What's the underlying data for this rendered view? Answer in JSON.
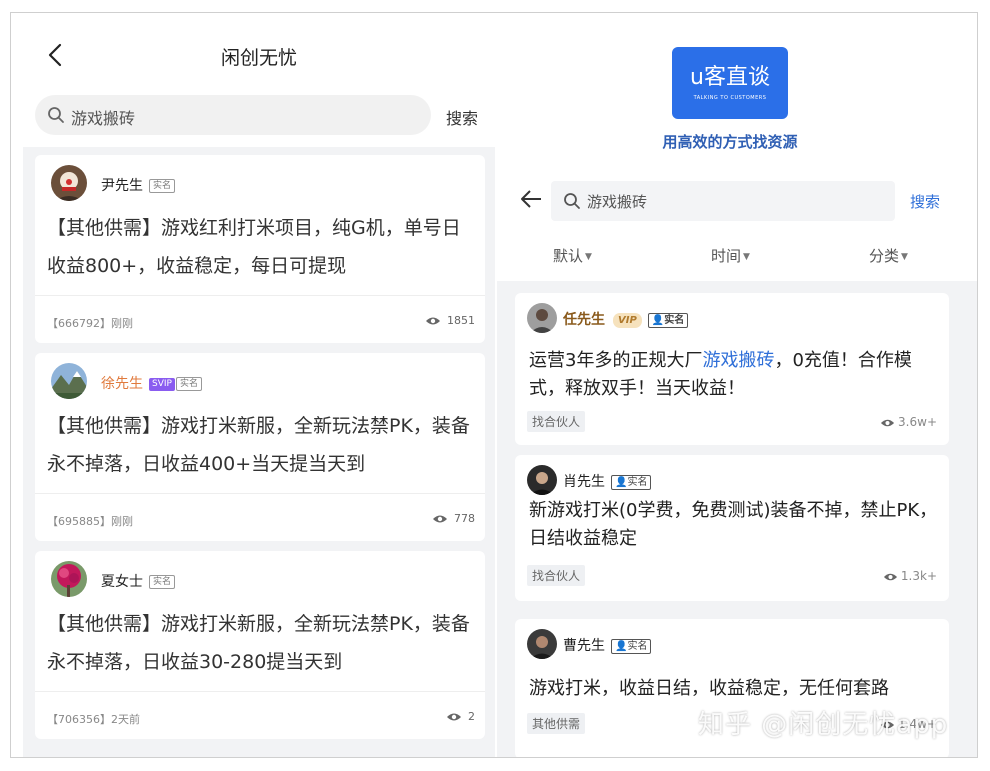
{
  "left": {
    "title": "闲创无忧",
    "search": {
      "value": "游戏搬砖",
      "button": "搜索"
    },
    "posts": [
      {
        "user": "尹先生",
        "badges": [
          "实名"
        ],
        "content": "【其他供需】游戏红利打米项目，纯G机，单号日收益800+，收益稳定，每日可提现",
        "meta": "【666792】刚刚",
        "views": "1851"
      },
      {
        "user": "徐先生",
        "badges": [
          "SVIP",
          "实名"
        ],
        "content": "【其他供需】游戏打米新服，全新玩法禁PK，装备永不掉落，日收益400+当天提当天到",
        "meta": "【695885】刚刚",
        "views": "778"
      },
      {
        "user": "夏女士",
        "badges": [
          "实名"
        ],
        "content": "【其他供需】游戏打米新服，全新玩法禁PK，装备永不掉落，日收益30-280提当天到",
        "meta": "【706356】2天前",
        "views": "2"
      }
    ]
  },
  "right": {
    "brand": {
      "logo_text": "u客直谈",
      "logo_sub": "TALKING TO CUSTOMERS",
      "slogan": "用高效的方式找资源"
    },
    "search": {
      "value": "游戏搬砖",
      "button": "搜索"
    },
    "filters": [
      "默认",
      "时间",
      "分类"
    ],
    "posts": [
      {
        "user": "任先生",
        "vip": "VIP",
        "badge": "实名",
        "content_pre": "运营3年多的正规大厂",
        "content_hl": "游戏搬砖",
        "content_post": "，0充值！合作模式，释放双手！当天收益！",
        "tag": "找合伙人",
        "views": "3.6w+"
      },
      {
        "user": "肖先生",
        "badge": "实名",
        "content": "新游戏打米(0学费，免费测试)装备不掉，禁止PK，日结收益稳定",
        "tag": "找合伙人",
        "views": "1.3k+"
      },
      {
        "user": "曹先生",
        "badge": "实名",
        "content": "游戏打米，收益日结，收益稳定，无任何套路",
        "tag": "其他供需",
        "views": "1.4w+"
      }
    ]
  },
  "watermark": "知乎 @闲创无忧app",
  "colors": {
    "accent_blue": "#2f6fd8",
    "svip_purple": "#8a5cf0",
    "vip_gold": "#f6e2bd",
    "feed_bg": "#f2f3f5"
  }
}
